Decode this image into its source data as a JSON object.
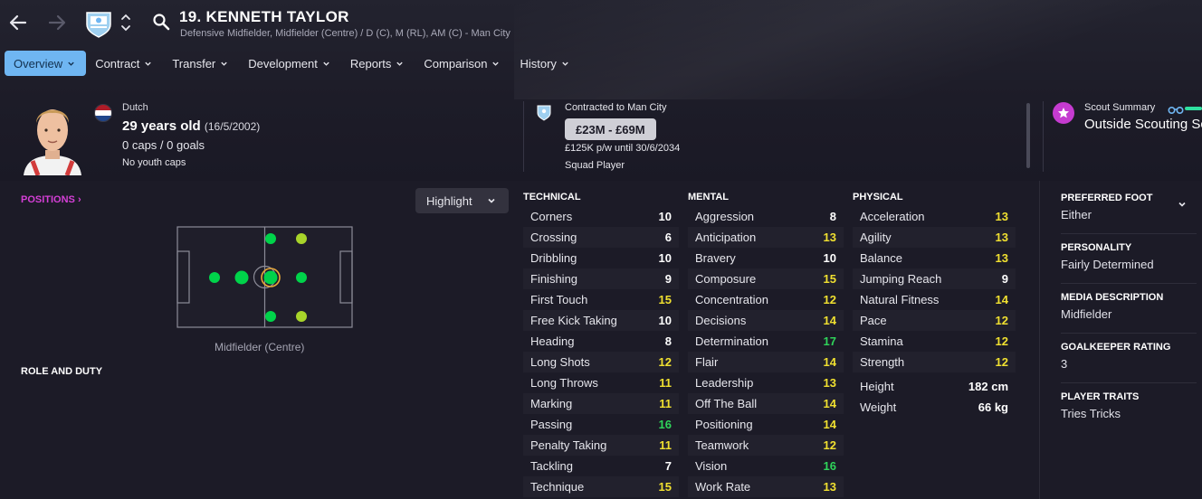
{
  "header": {
    "player_name": "19. KENNETH TAYLOR",
    "positions": "Defensive Midfielder, Midfielder (Centre) / D (C), M (RL), AM (C) - Man City"
  },
  "tabs": [
    {
      "label": "Overview"
    },
    {
      "label": "Contract"
    },
    {
      "label": "Transfer"
    },
    {
      "label": "Development"
    },
    {
      "label": "Reports"
    },
    {
      "label": "Comparison"
    },
    {
      "label": "History"
    }
  ],
  "personal": {
    "nationality": "Dutch",
    "age": "29 years old",
    "dob": "(16/5/2002)",
    "caps": "0 caps / 0 goals",
    "youth": "No youth caps"
  },
  "contract": {
    "club": "Contracted to Man City",
    "value": "£23M - £69M",
    "wage": "£125K p/w until 30/6/2034",
    "status": "Squad Player"
  },
  "scout": {
    "title": "Scout Summary",
    "value": "Outside Scouting Scope"
  },
  "positions_panel": {
    "link": "POSITIONS",
    "highlight_button": "Highlight",
    "pitch_caption": "Midfielder (Centre)",
    "role_duty": "ROLE AND DUTY"
  },
  "colors": {
    "accent": "#6fb6f2",
    "value_high": "#2fd45a",
    "value_mid": "#f0e030",
    "value_low": "#ffffff"
  },
  "attributes": {
    "technical": {
      "title": "TECHNICAL",
      "rows": [
        {
          "name": "Corners",
          "value": "10"
        },
        {
          "name": "Crossing",
          "value": "6"
        },
        {
          "name": "Dribbling",
          "value": "10"
        },
        {
          "name": "Finishing",
          "value": "9"
        },
        {
          "name": "First Touch",
          "value": "15"
        },
        {
          "name": "Free Kick Taking",
          "value": "10"
        },
        {
          "name": "Heading",
          "value": "8"
        },
        {
          "name": "Long Shots",
          "value": "12"
        },
        {
          "name": "Long Throws",
          "value": "11"
        },
        {
          "name": "Marking",
          "value": "11"
        },
        {
          "name": "Passing",
          "value": "16"
        },
        {
          "name": "Penalty Taking",
          "value": "11"
        },
        {
          "name": "Tackling",
          "value": "7"
        },
        {
          "name": "Technique",
          "value": "15"
        }
      ]
    },
    "mental": {
      "title": "MENTAL",
      "rows": [
        {
          "name": "Aggression",
          "value": "8"
        },
        {
          "name": "Anticipation",
          "value": "13"
        },
        {
          "name": "Bravery",
          "value": "10"
        },
        {
          "name": "Composure",
          "value": "15"
        },
        {
          "name": "Concentration",
          "value": "12"
        },
        {
          "name": "Decisions",
          "value": "14"
        },
        {
          "name": "Determination",
          "value": "17"
        },
        {
          "name": "Flair",
          "value": "14"
        },
        {
          "name": "Leadership",
          "value": "13"
        },
        {
          "name": "Off The Ball",
          "value": "14"
        },
        {
          "name": "Positioning",
          "value": "14"
        },
        {
          "name": "Teamwork",
          "value": "12"
        },
        {
          "name": "Vision",
          "value": "16"
        },
        {
          "name": "Work Rate",
          "value": "13"
        }
      ]
    },
    "physical": {
      "title": "PHYSICAL",
      "rows": [
        {
          "name": "Acceleration",
          "value": "13"
        },
        {
          "name": "Agility",
          "value": "13"
        },
        {
          "name": "Balance",
          "value": "13"
        },
        {
          "name": "Jumping Reach",
          "value": "9"
        },
        {
          "name": "Natural Fitness",
          "value": "14"
        },
        {
          "name": "Pace",
          "value": "12"
        },
        {
          "name": "Stamina",
          "value": "12"
        },
        {
          "name": "Strength",
          "value": "12"
        }
      ]
    },
    "height_label": "Height",
    "height": "182 cm",
    "weight_label": "Weight",
    "weight": "66 kg"
  },
  "sidebar": {
    "preferred_foot_label": "PREFERRED FOOT",
    "preferred_foot": "Either",
    "personality_label": "PERSONALITY",
    "personality": "Fairly Determined",
    "media_label": "MEDIA DESCRIPTION",
    "media": "Midfielder",
    "gk_label": "GOALKEEPER RATING",
    "gk": "3",
    "traits_label": "PLAYER TRAITS",
    "traits": "Tries Tricks"
  }
}
